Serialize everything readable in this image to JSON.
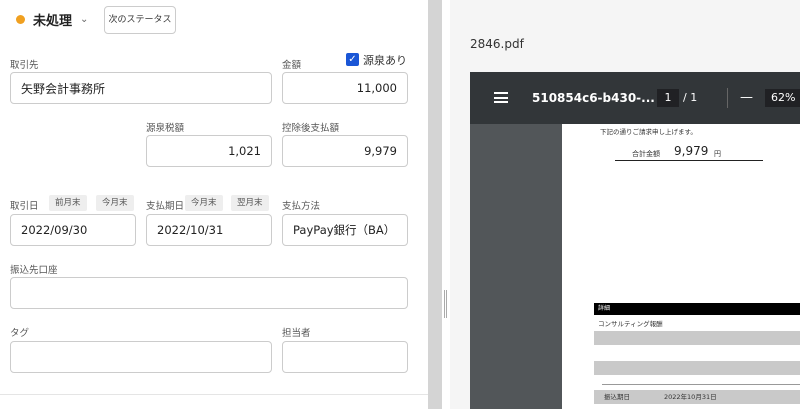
{
  "status": {
    "label": "未処理",
    "next_button": "次のステータス",
    "color": "#f0a020"
  },
  "form": {
    "client_label": "取引先",
    "client_value": "矢野会計事務所",
    "amount_label": "金額",
    "amount_value": "11,000",
    "withholding_checkbox_label": "源泉あり",
    "withholding_checked": true,
    "withholding_tax_label": "源泉税額",
    "withholding_tax_value": "1,021",
    "net_payment_label": "控除後支払額",
    "net_payment_value": "9,979",
    "transaction_date_label": "取引日",
    "transaction_date_quick": [
      "前月末",
      "今月末"
    ],
    "transaction_date_value": "2022/09/30",
    "due_date_label": "支払期日",
    "due_date_quick": [
      "今月末",
      "翌月末"
    ],
    "due_date_value": "2022/10/31",
    "payment_method_label": "支払方法",
    "payment_method_value": "PayPay銀行（BA）",
    "bank_account_label": "振込先口座",
    "bank_account_value": "",
    "tags_label": "タグ",
    "tags_value": "",
    "assignee_label": "担当者",
    "assignee_value": ""
  },
  "preview": {
    "file_name": "2846.pdf",
    "viewer": {
      "doc_title": "510854c6-b430-...",
      "current_page": "1",
      "total_pages": "/ 1",
      "zoom": "62%",
      "toolbar_color": "#323639"
    },
    "pdf": {
      "intro_text": "下記の通りご請求申し上げます。",
      "total_label": "合計金額",
      "total_value": "9,979",
      "total_unit": "円",
      "detail_header": "詳細",
      "item_name": "コンサルティング報酬",
      "due_label": "振込期日",
      "due_value": "2022年10月31日"
    }
  }
}
